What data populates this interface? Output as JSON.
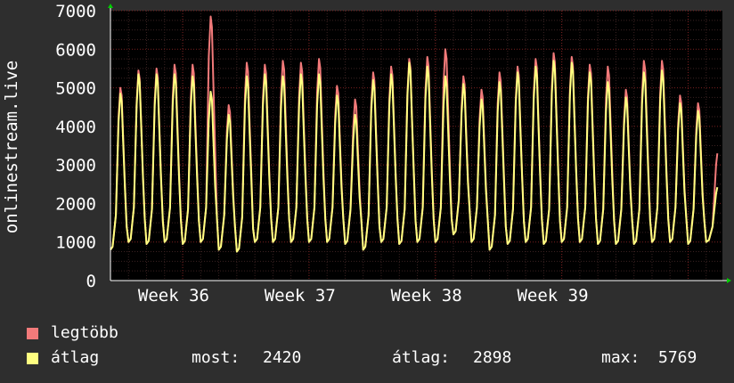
{
  "colors": {
    "background": "#2e2e2e",
    "plot_background": "#000000",
    "grid_minor": "#3a2222",
    "grid_major": "#7a2020",
    "axis": "#ffffff",
    "series_max": "#f27a7a",
    "series_avg": "#ffff80",
    "axis_arrow": "#00cc00"
  },
  "chart_data": {
    "type": "line",
    "ylabel": "onlinestream.live",
    "ylim": [
      0,
      7000
    ],
    "yticks": [
      0,
      1000,
      2000,
      3000,
      4000,
      5000,
      6000,
      7000
    ],
    "xlim": [
      0,
      33.9
    ],
    "x_unit": "days",
    "x_ticks": [
      {
        "label": "Week 36",
        "x": 3.5
      },
      {
        "label": "Week 37",
        "x": 10.5
      },
      {
        "label": "Week 38",
        "x": 17.5
      },
      {
        "label": "Week 39",
        "x": 24.5
      }
    ],
    "day_boundaries": [
      0,
      1,
      2,
      3,
      4,
      5,
      6,
      7,
      8,
      9,
      10,
      11,
      12,
      13,
      14,
      15,
      16,
      17,
      18,
      19,
      20,
      21,
      22,
      23,
      24,
      25,
      26,
      27,
      28,
      29,
      30,
      31,
      32,
      33
    ],
    "daily": [
      {
        "day": 0,
        "peak_max": 5000,
        "peak_avg": 4850,
        "trough": 800
      },
      {
        "day": 1,
        "peak_max": 5450,
        "peak_avg": 5350,
        "trough": 1000
      },
      {
        "day": 2,
        "peak_max": 5500,
        "peak_avg": 5350,
        "trough": 950
      },
      {
        "day": 3,
        "peak_max": 5600,
        "peak_avg": 5350,
        "trough": 1000
      },
      {
        "day": 4,
        "peak_max": 5600,
        "peak_avg": 5300,
        "trough": 950
      },
      {
        "day": 5,
        "peak_max": 6850,
        "peak_avg": 4900,
        "trough": 1000
      },
      {
        "day": 6,
        "peak_max": 4550,
        "peak_avg": 4300,
        "trough": 800
      },
      {
        "day": 7,
        "peak_max": 5650,
        "peak_avg": 5300,
        "trough": 750
      },
      {
        "day": 8,
        "peak_max": 5600,
        "peak_avg": 5350,
        "trough": 1000
      },
      {
        "day": 9,
        "peak_max": 5700,
        "peak_avg": 5300,
        "trough": 1000
      },
      {
        "day": 10,
        "peak_max": 5650,
        "peak_avg": 5350,
        "trough": 1000
      },
      {
        "day": 11,
        "peak_max": 5750,
        "peak_avg": 5350,
        "trough": 1000
      },
      {
        "day": 12,
        "peak_max": 5050,
        "peak_avg": 4800,
        "trough": 1000
      },
      {
        "day": 13,
        "peak_max": 4700,
        "peak_avg": 4300,
        "trough": 950
      },
      {
        "day": 14,
        "peak_max": 5400,
        "peak_avg": 5200,
        "trough": 800
      },
      {
        "day": 15,
        "peak_max": 5550,
        "peak_avg": 5350,
        "trough": 1000
      },
      {
        "day": 16,
        "peak_max": 5750,
        "peak_avg": 5650,
        "trough": 950
      },
      {
        "day": 17,
        "peak_max": 5800,
        "peak_avg": 5550,
        "trough": 1000
      },
      {
        "day": 18,
        "peak_max": 6000,
        "peak_avg": 5300,
        "trough": 1000
      },
      {
        "day": 19,
        "peak_max": 5300,
        "peak_avg": 5100,
        "trough": 1200
      },
      {
        "day": 20,
        "peak_max": 4950,
        "peak_avg": 4700,
        "trough": 1000
      },
      {
        "day": 21,
        "peak_max": 5400,
        "peak_avg": 5150,
        "trough": 800
      },
      {
        "day": 22,
        "peak_max": 5550,
        "peak_avg": 5400,
        "trough": 950
      },
      {
        "day": 23,
        "peak_max": 5750,
        "peak_avg": 5550,
        "trough": 1000
      },
      {
        "day": 24,
        "peak_max": 5900,
        "peak_avg": 5700,
        "trough": 950
      },
      {
        "day": 25,
        "peak_max": 5800,
        "peak_avg": 5650,
        "trough": 1000
      },
      {
        "day": 26,
        "peak_max": 5600,
        "peak_avg": 5400,
        "trough": 1000
      },
      {
        "day": 27,
        "peak_max": 5550,
        "peak_avg": 5150,
        "trough": 950
      },
      {
        "day": 28,
        "peak_max": 4950,
        "peak_avg": 4750,
        "trough": 950
      },
      {
        "day": 29,
        "peak_max": 5700,
        "peak_avg": 5400,
        "trough": 950
      },
      {
        "day": 30,
        "peak_max": 5700,
        "peak_avg": 5450,
        "trough": 1000
      },
      {
        "day": 31,
        "peak_max": 4800,
        "peak_avg": 4600,
        "trough": 1000
      },
      {
        "day": 32,
        "peak_max": 4600,
        "peak_avg": 4400,
        "trough": 950
      },
      {
        "day": 33,
        "peak_max": 3300,
        "peak_avg": 2420,
        "trough": 1000
      }
    ],
    "series": [
      {
        "name": "legtöbb",
        "color": "#f27a7a"
      },
      {
        "name": "átlag",
        "color": "#ffff80"
      }
    ],
    "grid": true,
    "legend_position": "bottom-left"
  },
  "legend": {
    "max_label": "legtöbb",
    "avg_label": "átlag"
  },
  "stats": {
    "now_label": "most:",
    "now_value": "2420",
    "avg_label": "átlag:",
    "avg_value": "2898",
    "max_label": "max:",
    "max_value": "5769"
  }
}
